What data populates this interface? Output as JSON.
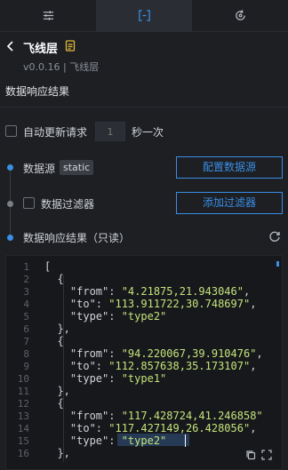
{
  "tabs": [
    {
      "icon": "sliders-icon"
    },
    {
      "icon": "brackets-icon"
    },
    {
      "icon": "refresh-cube-icon"
    }
  ],
  "header": {
    "title": "飞线层",
    "version": "v0.0.16 | 飞线层"
  },
  "section": {
    "title": "数据响应结果"
  },
  "auto_update": {
    "label": "自动更新请求",
    "interval_placeholder": "1",
    "unit": "秒一次"
  },
  "pipeline": {
    "source_label": "数据源",
    "source_badge": "static",
    "config_button": "配置数据源",
    "filter_label": "数据过滤器",
    "add_filter_button": "添加过滤器",
    "result_label": "数据响应结果（只读）"
  },
  "code": {
    "lines": [
      {
        "n": "1",
        "t": "["
      },
      {
        "n": "2",
        "t": "  {"
      },
      {
        "n": "3",
        "t": "    \"from\": \"4.21875,21.943046\","
      },
      {
        "n": "4",
        "t": "    \"to\": \"113.911722,30.748697\","
      },
      {
        "n": "5",
        "t": "    \"type\": \"type2\""
      },
      {
        "n": "6",
        "t": "  },"
      },
      {
        "n": "7",
        "t": "  {"
      },
      {
        "n": "8",
        "t": "    \"from\": \"94.220067,39.910476\","
      },
      {
        "n": "9",
        "t": "    \"to\": \"112.857638,35.173107\","
      },
      {
        "n": "10",
        "t": "    \"type\": \"type1\""
      },
      {
        "n": "11",
        "t": "  },"
      },
      {
        "n": "12",
        "t": "  {"
      },
      {
        "n": "13",
        "t": "    \"from\": \"117.428724,41.246858\""
      },
      {
        "n": "14",
        "t": "    \"to\": \"117.427149,26.428056\","
      },
      {
        "n": "15",
        "t": "    \"type\": \"type2\""
      },
      {
        "n": "16",
        "t": "  },"
      }
    ]
  },
  "colors": {
    "accent": "#3a8ee6",
    "string": "#c4e37a",
    "background": "#1d1f23"
  }
}
